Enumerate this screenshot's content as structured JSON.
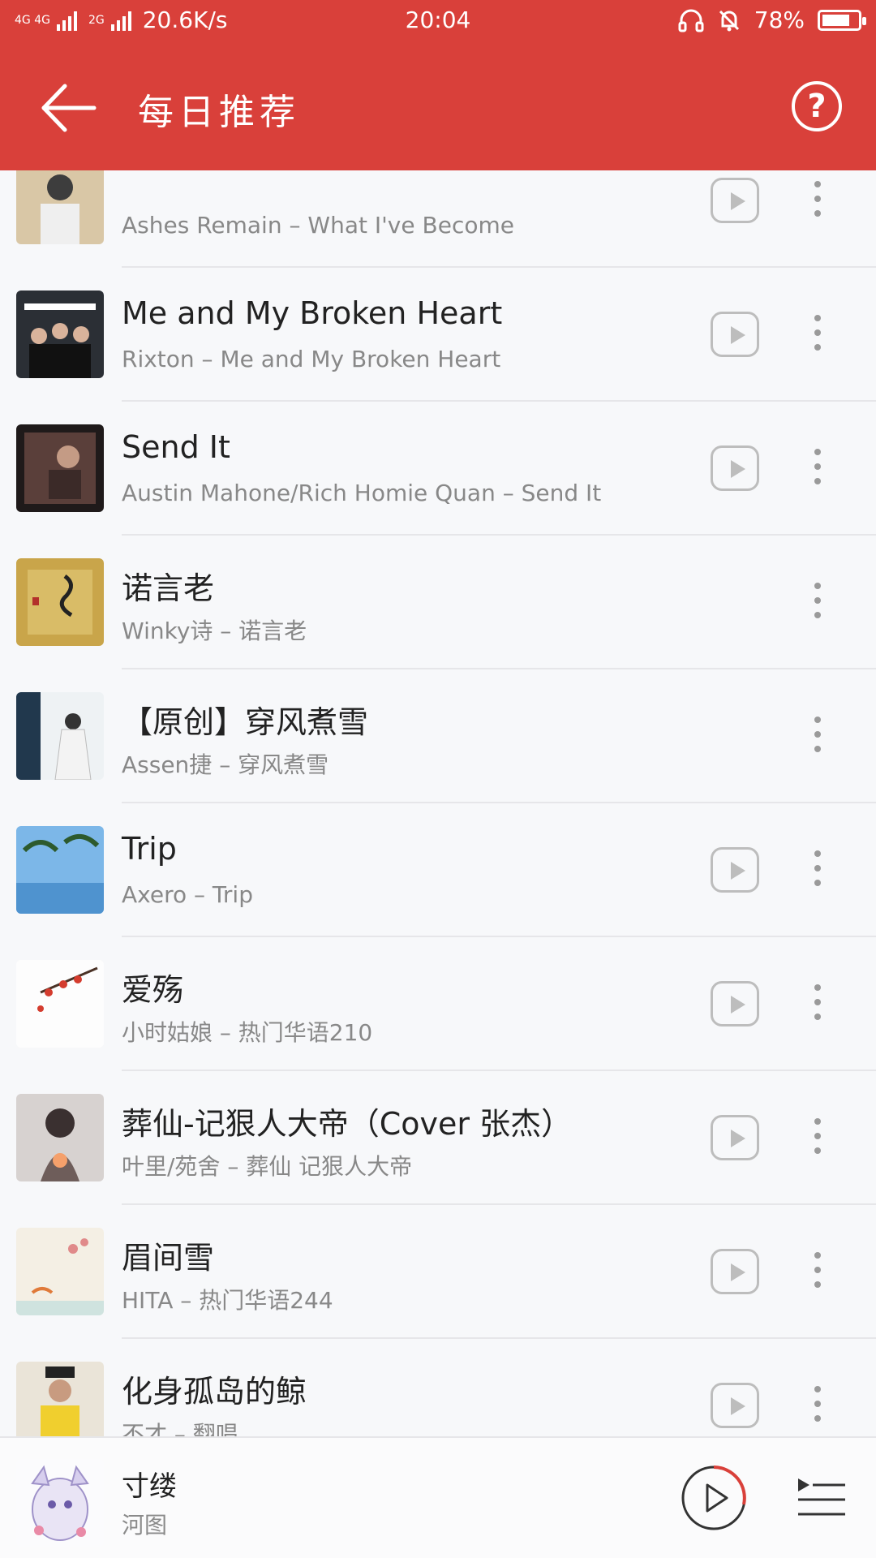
{
  "statusbar": {
    "network_label_top": "4G 4G",
    "network_label_2g": "2G",
    "speed": "20.6K/s",
    "time": "20:04",
    "battery": "78%",
    "battery_level": 0.78
  },
  "appbar": {
    "title": "每日推荐"
  },
  "songs": [
    {
      "title": "",
      "subtitle": "Ashes Remain – What I've Become",
      "has_mv": true
    },
    {
      "title": "Me and My Broken Heart",
      "subtitle": "Rixton – Me and My Broken Heart",
      "has_mv": true
    },
    {
      "title": "Send It",
      "subtitle": "Austin Mahone/Rich Homie Quan – Send It",
      "has_mv": true
    },
    {
      "title": "诺言老",
      "subtitle": "Winky诗 – 诺言老",
      "has_mv": false
    },
    {
      "title": "【原创】穿风煮雪",
      "subtitle": "Assen捷 – 穿风煮雪",
      "has_mv": false
    },
    {
      "title": "Trip",
      "subtitle": "Axero – Trip",
      "has_mv": true
    },
    {
      "title": "爱殇",
      "subtitle": "小时姑娘 – 热门华语210",
      "has_mv": true
    },
    {
      "title": "葬仙-记狠人大帝（Cover 张杰）",
      "subtitle": "叶里/苑舍 – 葬仙 记狠人大帝",
      "has_mv": true
    },
    {
      "title": "眉间雪",
      "subtitle": "HITA – 热门华语244",
      "has_mv": true
    },
    {
      "title": "化身孤岛的鲸",
      "subtitle": "不才 – 翻唱",
      "has_mv": true
    }
  ],
  "player": {
    "title": "寸缕",
    "artist": "河图"
  },
  "colors": {
    "brand_red": "#d9403a",
    "player_ring_red": "#d9403a"
  }
}
